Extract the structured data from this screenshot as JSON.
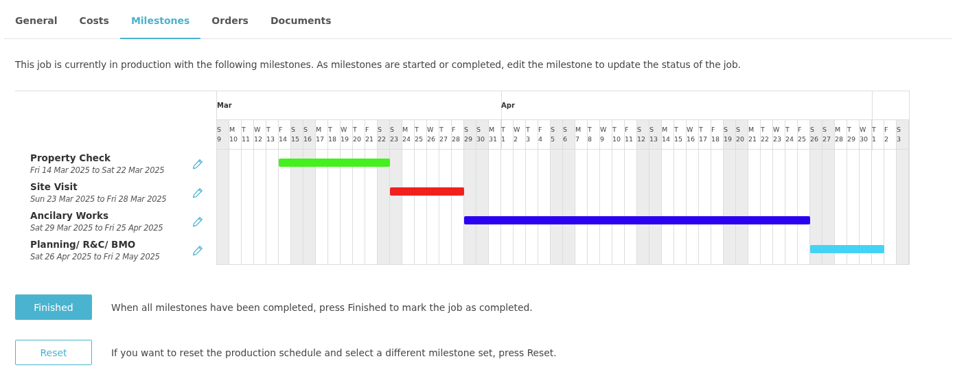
{
  "tabs": [
    {
      "label": "General",
      "selected": false
    },
    {
      "label": "Costs",
      "selected": false
    },
    {
      "label": "Milestones",
      "selected": true
    },
    {
      "label": "Orders",
      "selected": false
    },
    {
      "label": "Documents",
      "selected": false
    }
  ],
  "intro": "This job is currently in production with the following milestones. As milestones are started or completed, edit the milestone to update the status of the job.",
  "gantt": {
    "months": [
      {
        "label": "Mar",
        "days": [
          {
            "letter": "S",
            "number": "9",
            "weekend": true
          },
          {
            "letter": "M",
            "number": "10",
            "weekend": false
          },
          {
            "letter": "T",
            "number": "11",
            "weekend": false
          },
          {
            "letter": "W",
            "number": "12",
            "weekend": false
          },
          {
            "letter": "T",
            "number": "13",
            "weekend": false
          },
          {
            "letter": "F",
            "number": "14",
            "weekend": false
          },
          {
            "letter": "S",
            "number": "15",
            "weekend": true
          },
          {
            "letter": "S",
            "number": "16",
            "weekend": true
          },
          {
            "letter": "M",
            "number": "17",
            "weekend": false
          },
          {
            "letter": "T",
            "number": "18",
            "weekend": false
          },
          {
            "letter": "W",
            "number": "19",
            "weekend": false
          },
          {
            "letter": "T",
            "number": "20",
            "weekend": false
          },
          {
            "letter": "F",
            "number": "21",
            "weekend": false
          },
          {
            "letter": "S",
            "number": "22",
            "weekend": true
          },
          {
            "letter": "S",
            "number": "23",
            "weekend": true
          },
          {
            "letter": "M",
            "number": "24",
            "weekend": false
          },
          {
            "letter": "T",
            "number": "25",
            "weekend": false
          },
          {
            "letter": "W",
            "number": "26",
            "weekend": false
          },
          {
            "letter": "T",
            "number": "27",
            "weekend": false
          },
          {
            "letter": "F",
            "number": "28",
            "weekend": false
          },
          {
            "letter": "S",
            "number": "29",
            "weekend": true
          },
          {
            "letter": "S",
            "number": "30",
            "weekend": true
          },
          {
            "letter": "M",
            "number": "31",
            "weekend": false
          }
        ]
      },
      {
        "label": "Apr",
        "days": [
          {
            "letter": "T",
            "number": "1",
            "weekend": false
          },
          {
            "letter": "W",
            "number": "2",
            "weekend": false
          },
          {
            "letter": "T",
            "number": "3",
            "weekend": false
          },
          {
            "letter": "F",
            "number": "4",
            "weekend": false
          },
          {
            "letter": "S",
            "number": "5",
            "weekend": true
          },
          {
            "letter": "S",
            "number": "6",
            "weekend": true
          },
          {
            "letter": "M",
            "number": "7",
            "weekend": false
          },
          {
            "letter": "T",
            "number": "8",
            "weekend": false
          },
          {
            "letter": "W",
            "number": "9",
            "weekend": false
          },
          {
            "letter": "T",
            "number": "10",
            "weekend": false
          },
          {
            "letter": "F",
            "number": "11",
            "weekend": false
          },
          {
            "letter": "S",
            "number": "12",
            "weekend": true
          },
          {
            "letter": "S",
            "number": "13",
            "weekend": true
          },
          {
            "letter": "M",
            "number": "14",
            "weekend": false
          },
          {
            "letter": "T",
            "number": "15",
            "weekend": false
          },
          {
            "letter": "W",
            "number": "16",
            "weekend": false
          },
          {
            "letter": "T",
            "number": "17",
            "weekend": false
          },
          {
            "letter": "F",
            "number": "18",
            "weekend": false
          },
          {
            "letter": "S",
            "number": "19",
            "weekend": true
          },
          {
            "letter": "S",
            "number": "20",
            "weekend": true
          },
          {
            "letter": "M",
            "number": "21",
            "weekend": false
          },
          {
            "letter": "T",
            "number": "22",
            "weekend": false
          },
          {
            "letter": "W",
            "number": "23",
            "weekend": false
          },
          {
            "letter": "T",
            "number": "24",
            "weekend": false
          },
          {
            "letter": "F",
            "number": "25",
            "weekend": false
          },
          {
            "letter": "S",
            "number": "26",
            "weekend": true
          },
          {
            "letter": "S",
            "number": "27",
            "weekend": true
          },
          {
            "letter": "M",
            "number": "28",
            "weekend": false
          },
          {
            "letter": "T",
            "number": "29",
            "weekend": false
          },
          {
            "letter": "W",
            "number": "30",
            "weekend": false
          }
        ]
      },
      {
        "days": [
          {
            "letter": "T",
            "number": "1",
            "weekend": false
          },
          {
            "letter": "F",
            "number": "2",
            "weekend": false
          },
          {
            "letter": "S",
            "number": "3",
            "weekend": true
          }
        ]
      }
    ],
    "milestones": [
      {
        "name": "Property Check",
        "dates": "Fri 14 Mar 2025 to Sat 22 Mar 2025",
        "color": "#44f01e",
        "active": [
          false,
          false,
          false,
          false,
          false,
          true,
          true,
          true,
          true,
          true,
          true,
          true,
          true,
          true,
          false,
          false,
          false,
          false,
          false,
          false,
          false,
          false,
          false,
          false,
          false,
          false,
          false,
          false,
          false,
          false,
          false,
          false,
          false,
          false,
          false,
          false,
          false,
          false,
          false,
          false,
          false,
          false,
          false,
          false,
          false,
          false,
          false,
          false,
          false,
          false,
          false,
          false,
          false,
          false,
          false,
          false
        ]
      },
      {
        "name": "Site Visit",
        "dates": "Sun 23 Mar 2025 to Fri 28 Mar 2025",
        "color": "#f0201e",
        "active": [
          false,
          false,
          false,
          false,
          false,
          false,
          false,
          false,
          false,
          false,
          false,
          false,
          false,
          false,
          true,
          true,
          true,
          true,
          true,
          true,
          false,
          false,
          false,
          false,
          false,
          false,
          false,
          false,
          false,
          false,
          false,
          false,
          false,
          false,
          false,
          false,
          false,
          false,
          false,
          false,
          false,
          false,
          false,
          false,
          false,
          false,
          false,
          false,
          false,
          false,
          false,
          false,
          false,
          false,
          false,
          false
        ]
      },
      {
        "name": "Ancilary Works",
        "dates": "Sat 29 Mar 2025 to Fri 25 Apr 2025",
        "color": "#2a00f0",
        "active": [
          false,
          false,
          false,
          false,
          false,
          false,
          false,
          false,
          false,
          false,
          false,
          false,
          false,
          false,
          false,
          false,
          false,
          false,
          false,
          false,
          true,
          true,
          true,
          true,
          true,
          true,
          true,
          true,
          true,
          true,
          true,
          true,
          true,
          true,
          true,
          true,
          true,
          true,
          true,
          true,
          true,
          true,
          true,
          true,
          true,
          true,
          true,
          true,
          false,
          false,
          false,
          false,
          false,
          false,
          false,
          false
        ]
      },
      {
        "name": "Planning/ R&C/ BMO",
        "dates": "Sat 26 Apr 2025 to Fri 2 May 2025",
        "color": "#45d3f5",
        "active": [
          false,
          false,
          false,
          false,
          false,
          false,
          false,
          false,
          false,
          false,
          false,
          false,
          false,
          false,
          false,
          false,
          false,
          false,
          false,
          false,
          false,
          false,
          false,
          false,
          false,
          false,
          false,
          false,
          false,
          false,
          false,
          false,
          false,
          false,
          false,
          false,
          false,
          false,
          false,
          false,
          false,
          false,
          false,
          false,
          false,
          false,
          false,
          false,
          true,
          true,
          true,
          true,
          true,
          true,
          false,
          false
        ]
      }
    ]
  },
  "actions": [
    {
      "kind": "primary",
      "label": "Finished",
      "note": "When all milestones have been completed, press Finished to mark the job as completed."
    },
    {
      "kind": "outline",
      "label": "Reset",
      "note": "If you want to reset the production schedule and select a different milestone set, press Reset."
    }
  ]
}
